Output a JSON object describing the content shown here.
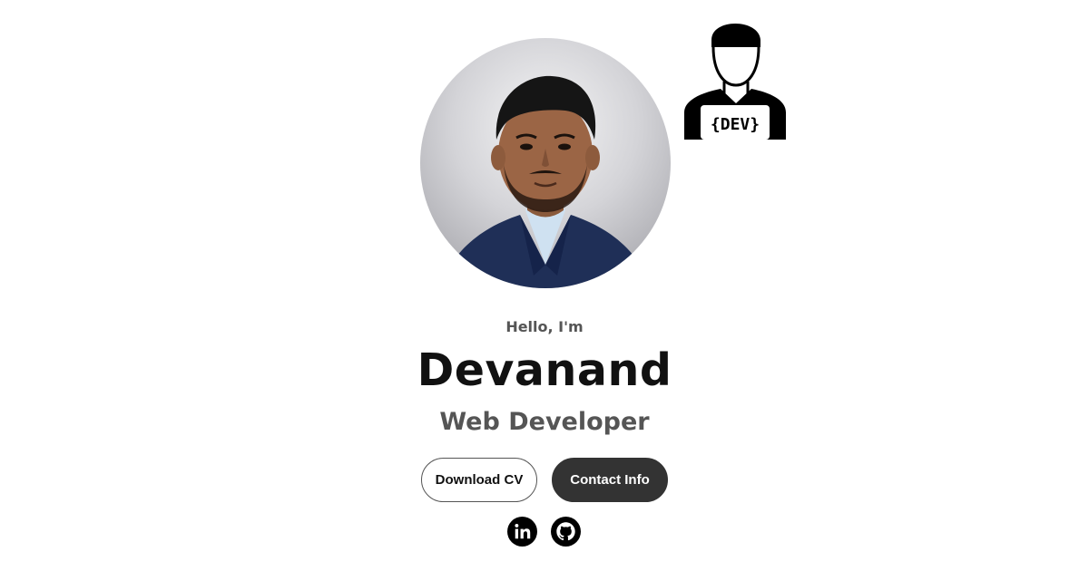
{
  "profile": {
    "photo_alt": "Devanand profile photo",
    "badge_text": "{DEV}"
  },
  "hero": {
    "greeting": "Hello, I'm",
    "name": "Devanand",
    "role": "Web Developer"
  },
  "buttons": {
    "download_cv": "Download CV",
    "contact_info": "Contact Info"
  },
  "social": [
    {
      "icon": "linkedin-icon"
    },
    {
      "icon": "github-icon"
    }
  ],
  "colors": {
    "text_dark": "#111111",
    "text_muted": "#555555",
    "button_dark": "#333333",
    "background": "#ffffff"
  }
}
